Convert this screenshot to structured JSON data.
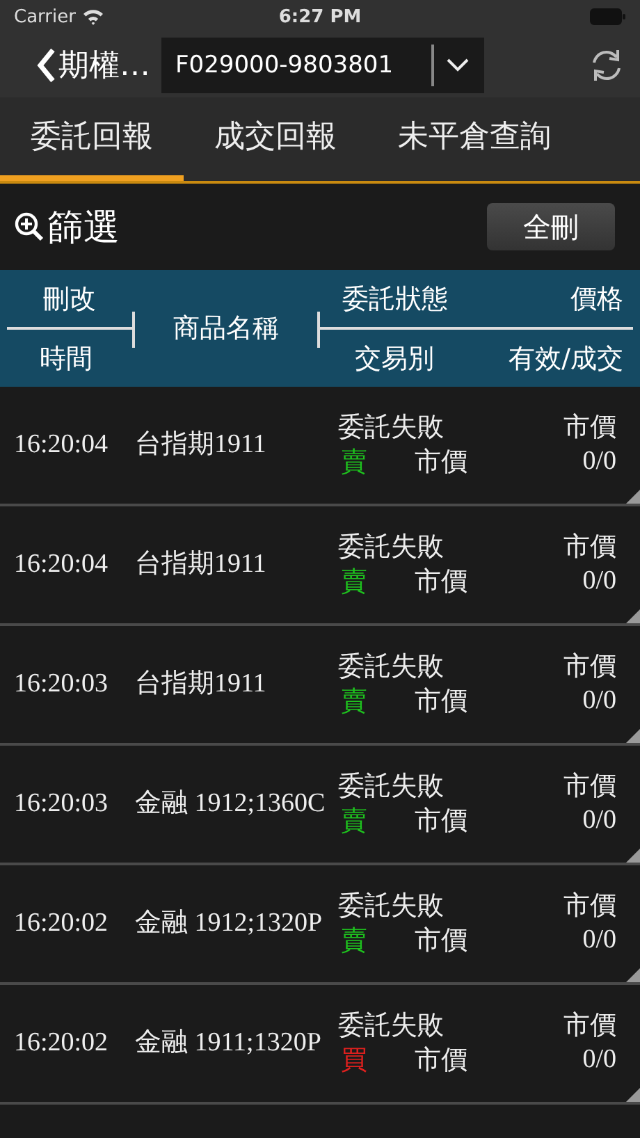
{
  "status_bar": {
    "carrier": "Carrier",
    "time": "6:27 PM"
  },
  "nav": {
    "back_label": "期權…",
    "account": "F029000-9803801"
  },
  "tabs": [
    {
      "label": "委託回報",
      "selected": true
    },
    {
      "label": "成交回報",
      "selected": false
    },
    {
      "label": "未平倉查詢",
      "selected": false
    }
  ],
  "filter": {
    "label": "篩選",
    "delete_all": "全刪"
  },
  "header": {
    "edit": "刪改",
    "time": "時間",
    "product": "商品名稱",
    "status": "委託狀態",
    "price": "價格",
    "trade_type": "交易別",
    "valid_filled": "有效/成交"
  },
  "rows": [
    {
      "time": "16:20:04",
      "product": "台指期1911",
      "status": "委託失敗",
      "price": "市價",
      "side": "賣",
      "color": "#1ec31e",
      "order_type": "市價",
      "filled": "0/0"
    },
    {
      "time": "16:20:04",
      "product": "台指期1911",
      "status": "委託失敗",
      "price": "市價",
      "side": "賣",
      "color": "#1ec31e",
      "order_type": "市價",
      "filled": "0/0"
    },
    {
      "time": "16:20:03",
      "product": "台指期1911",
      "status": "委託失敗",
      "price": "市價",
      "side": "賣",
      "color": "#1ec31e",
      "order_type": "市價",
      "filled": "0/0"
    },
    {
      "time": "16:20:03",
      "product": "金融 1912;1360C",
      "status": "委託失敗",
      "price": "市價",
      "side": "賣",
      "color": "#1ec31e",
      "order_type": "市價",
      "filled": "0/0"
    },
    {
      "time": "16:20:02",
      "product": "金融 1912;1320P",
      "status": "委託失敗",
      "price": "市價",
      "side": "賣",
      "color": "#1ec31e",
      "order_type": "市價",
      "filled": "0/0"
    },
    {
      "time": "16:20:02",
      "product": "金融 1911;1320P",
      "status": "委託失敗",
      "price": "市價",
      "side": "買",
      "color": "#e0201e",
      "order_type": "市價",
      "filled": "0/0"
    }
  ]
}
